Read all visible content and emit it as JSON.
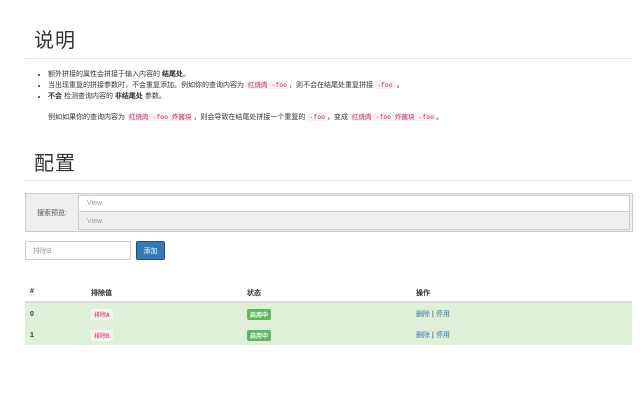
{
  "description": {
    "title": "说明",
    "items": [
      {
        "text": "额外拼接的属性会拼接于输入内容的",
        "bold": "结尾处",
        "end": "。"
      },
      {
        "pre": "当出现重复的拼接参数时，不会重复添加。例如你的查询内容为",
        "code1": "红烧肉 -foo",
        "mid": "，则不会在结尾处重复拼接",
        "code2": "-foo",
        "end": "。"
      },
      {
        "bold1": "不会",
        "mid": "检测查询内容的",
        "bold2": "非结尾处",
        "end": "参数。"
      }
    ],
    "example": {
      "a": "例如如果你的查询内容为",
      "code1": "红烧肉 -foo 炸酱块",
      "b": "，则会导致在结尾处拼接一个重复的",
      "code2": "-foo",
      "c": "，变成",
      "code3": "红烧肉 -foo 炸酱块 -foo",
      "d": "。"
    }
  },
  "config": {
    "title": "配置",
    "preview_label": "搜索预览:",
    "preview_values": [
      "View",
      "View"
    ],
    "add_placeholder": "排除B",
    "add_button": "添加"
  },
  "table": {
    "headers": [
      "#",
      "排除值",
      "状态",
      "操作"
    ],
    "rows": [
      {
        "index": "0",
        "value": "排除A",
        "status": "启用中",
        "delete": "删除",
        "sep": "|",
        "disable": "停用"
      },
      {
        "index": "1",
        "value": "排除B",
        "status": "启用中",
        "delete": "删除",
        "sep": "|",
        "disable": "停用"
      }
    ]
  },
  "colors": {
    "accent": "#337ab7",
    "success": "#5cb85c",
    "row_bg": "#dff0d8",
    "code": "#c7254e"
  }
}
